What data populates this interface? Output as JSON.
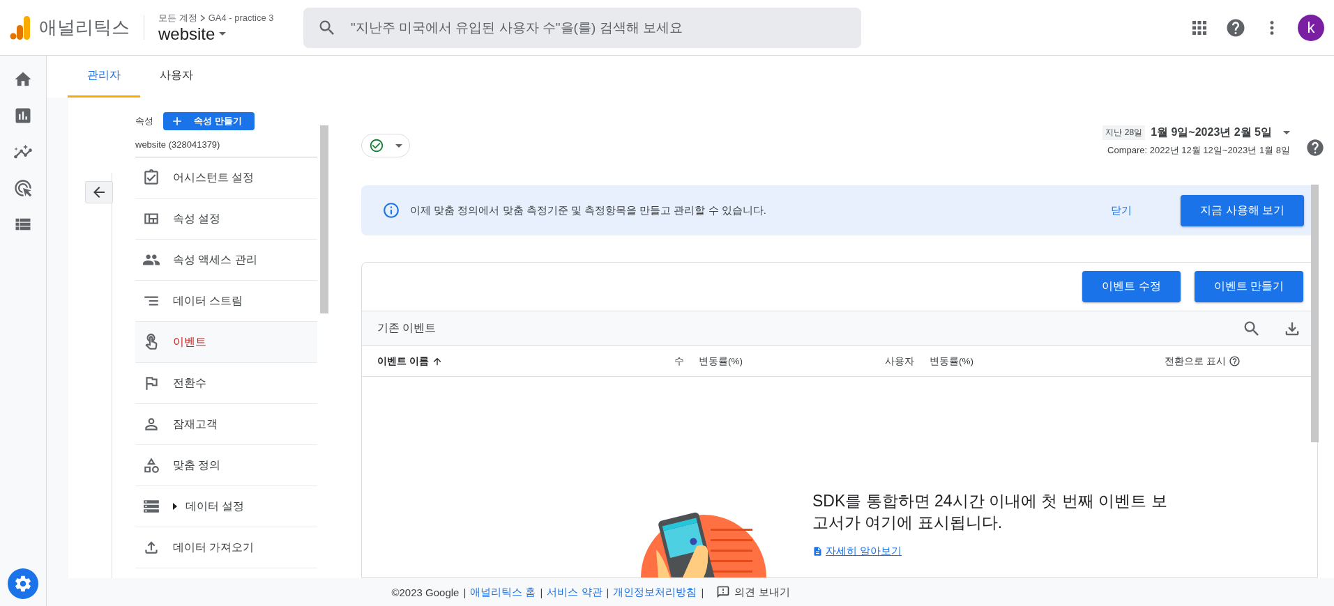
{
  "header": {
    "app_name": "애널리틱스",
    "breadcrumb": "모든 계정",
    "breadcrumb_child": "GA4 - practice 3",
    "property": "website",
    "avatar": "k"
  },
  "search": {
    "placeholder": "\"지난주 미국에서 유입된 사용자 수\"을(를) 검색해 보세요"
  },
  "tabs": [
    {
      "label": "관리자",
      "selected": true
    },
    {
      "label": "사용자",
      "selected": false
    }
  ],
  "property_panel": {
    "label": "속성",
    "create_button": "속성 만들기",
    "property_name": "website (328041379)",
    "items": [
      {
        "label": "어시스턴트 설정",
        "selected": false,
        "expandable": false
      },
      {
        "label": "속성 설정",
        "selected": false,
        "expandable": false
      },
      {
        "label": "속성 액세스 관리",
        "selected": false,
        "expandable": false
      },
      {
        "label": "데이터 스트림",
        "selected": false,
        "expandable": false
      },
      {
        "label": "이벤트",
        "selected": true,
        "expandable": false
      },
      {
        "label": "전환수",
        "selected": false,
        "expandable": false
      },
      {
        "label": "잠재고객",
        "selected": false,
        "expandable": false
      },
      {
        "label": "맞춤 정의",
        "selected": false,
        "expandable": false
      },
      {
        "label": "데이터 설정",
        "selected": false,
        "expandable": true
      },
      {
        "label": "데이터 가져오기",
        "selected": false,
        "expandable": false
      }
    ]
  },
  "status": {
    "ok": true
  },
  "date": {
    "period": "지난 28일",
    "range": "1월 9일~2023년 2월 5일",
    "compare": "Compare: 2022년 12월 12일~2023년 1월 8일"
  },
  "banner": {
    "text": "이제 맞춤 정의에서 맞춤 측정기준 및 측정항목을 만들고 관리할 수 있습니다.",
    "dismiss": "닫기",
    "action": "지금 사용해 보기"
  },
  "events": {
    "buttons": [
      "이벤트 수정",
      "이벤트 만들기"
    ],
    "title": "기존 이벤트",
    "columns": [
      {
        "label": "이벤트 이름",
        "sorted": true,
        "help": false
      },
      {
        "label": "수",
        "sorted": false,
        "help": false
      },
      {
        "label": "변동률(%)",
        "sorted": false,
        "help": false
      },
      {
        "label": "사용자",
        "sorted": false,
        "help": false
      },
      {
        "label": "변동률(%)",
        "sorted": false,
        "help": false
      },
      {
        "label": "전환으로 표시",
        "sorted": false,
        "help": true
      }
    ],
    "empty_message": "SDK를 통합하면 24시간 이내에 첫 번째 이벤트 보고서가 여기에 표시됩니다.",
    "empty_link": "자세히 알아보기"
  },
  "footer": {
    "copyright": "©2023 Google",
    "separator": "|",
    "links": [
      "애널리틱스 홈",
      "서비스 약관",
      "개인정보처리방침"
    ],
    "feedback": "의견 보내기"
  }
}
